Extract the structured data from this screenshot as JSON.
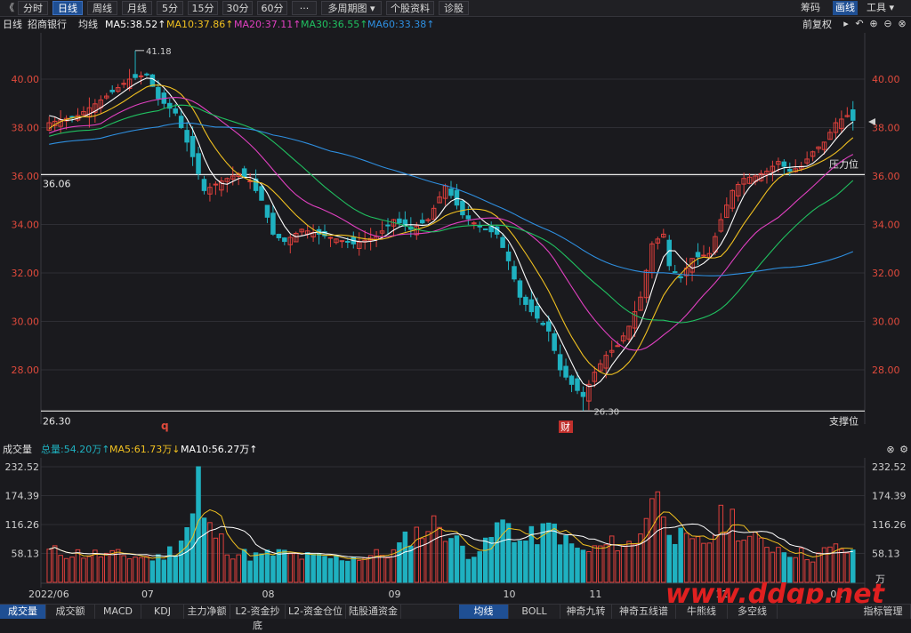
{
  "toolbar": {
    "back_glyph": "《",
    "tabs": [
      "分时",
      "日线",
      "周线",
      "月线",
      "5分",
      "15分",
      "30分",
      "60分",
      "···",
      "多周期图 ▾",
      "个股资料",
      "诊股"
    ],
    "active_tab": 1,
    "right": {
      "chips": "筹码",
      "draw": "画线",
      "tools": "工具 ▾"
    }
  },
  "legend": {
    "period": "日线",
    "stock": "招商银行",
    "mode": "均线",
    "ma5": "MA5:38.52↑",
    "ma10": "MA10:37.86↑",
    "ma20": "MA20:37.11↑",
    "ma30": "MA30:36.55↑",
    "ma60": "MA60:33.38↑",
    "adjust": "前复权",
    "colors": {
      "ma5": "#ffffff",
      "ma10": "#f0c020",
      "ma20": "#e040c0",
      "ma30": "#20c060",
      "ma60": "#2e8fe0",
      "up": "#e0403c",
      "down": "#1fb1c0"
    }
  },
  "volume_legend": {
    "title": "成交量",
    "total": "总量:54.20万↑",
    "ma5": "MA5:61.73万↓",
    "ma10": "MA10:56.27万↑"
  },
  "annotations": {
    "high_label": "41.18",
    "low_label": "26.30",
    "resistance_value": "36.06",
    "resistance_text": "压力位",
    "support_value": "26.30",
    "support_text": "支撑位",
    "q_marker": "q",
    "fin_marker": "财",
    "watermark": "www.ddgp.net",
    "vol_unit": "万"
  },
  "bottom_tabs": [
    "成交量",
    "成交额",
    "MACD",
    "KDJ",
    "主力净额",
    "L2-资金抄底",
    "L2-资金仓位",
    "陆股通资金",
    "均线",
    "BOLL",
    "神奇九转",
    "神奇五线谱",
    "牛熊线",
    "多空线",
    "指标管理"
  ],
  "bottom_active": [
    0,
    8
  ],
  "chart_data": [
    {
      "type": "candlestick",
      "title": "招商银行 日线",
      "ylim": [
        26.3,
        41.18
      ],
      "yticks": [
        28.0,
        30.0,
        32.0,
        34.0,
        36.0,
        38.0,
        40.0
      ],
      "ytick_labels": [
        "28.00",
        "30.00",
        "32.00",
        "34.00",
        "36.00",
        "38.00",
        "40.00"
      ],
      "xticks": [
        {
          "label": "2022/06",
          "index": 0
        },
        {
          "label": "07",
          "index": 17
        },
        {
          "label": "08",
          "index": 38
        },
        {
          "label": "09",
          "index": 60
        },
        {
          "label": "10",
          "index": 80
        },
        {
          "label": "11",
          "index": 95
        },
        {
          "label": "12",
          "index": 117
        },
        {
          "label": "01",
          "index": 137
        }
      ],
      "resistance": 36.06,
      "support": 26.3,
      "high": 41.18,
      "low": 26.3,
      "close_keypoints": [
        [
          0,
          38.2
        ],
        [
          5,
          38.5
        ],
        [
          10,
          39.3
        ],
        [
          14,
          40.0
        ],
        [
          17,
          40.2
        ],
        [
          19,
          39.2
        ],
        [
          22,
          38.6
        ],
        [
          25,
          36.8
        ],
        [
          27,
          35.4
        ],
        [
          30,
          35.8
        ],
        [
          33,
          36.1
        ],
        [
          35,
          35.8
        ],
        [
          37,
          35.0
        ],
        [
          39,
          33.6
        ],
        [
          41,
          33.3
        ],
        [
          44,
          33.8
        ],
        [
          47,
          33.6
        ],
        [
          50,
          33.4
        ],
        [
          53,
          33.2
        ],
        [
          57,
          33.5
        ],
        [
          60,
          34.2
        ],
        [
          63,
          33.8
        ],
        [
          66,
          34.2
        ],
        [
          69,
          35.6
        ],
        [
          72,
          34.4
        ],
        [
          75,
          33.9
        ],
        [
          78,
          33.6
        ],
        [
          80,
          32.5
        ],
        [
          82,
          31.0
        ],
        [
          84,
          30.4
        ],
        [
          87,
          29.6
        ],
        [
          89,
          28.0
        ],
        [
          91,
          27.4
        ],
        [
          93,
          26.9
        ],
        [
          95,
          27.9
        ],
        [
          97,
          28.6
        ],
        [
          99,
          29.0
        ],
        [
          101,
          29.8
        ],
        [
          103,
          31.0
        ],
        [
          105,
          33.2
        ],
        [
          107,
          33.6
        ],
        [
          108,
          32.3
        ],
        [
          110,
          31.8
        ],
        [
          112,
          32.6
        ],
        [
          115,
          32.8
        ],
        [
          117,
          34.2
        ],
        [
          119,
          35.4
        ],
        [
          121,
          35.9
        ],
        [
          123,
          36.0
        ],
        [
          125,
          36.2
        ],
        [
          127,
          36.6
        ],
        [
          129,
          36.2
        ],
        [
          131,
          36.4
        ],
        [
          133,
          37.0
        ],
        [
          135,
          37.4
        ],
        [
          137,
          38.2
        ],
        [
          139,
          38.5
        ],
        [
          140,
          38.3
        ]
      ],
      "series": [
        {
          "name": "MA5",
          "last": 38.52
        },
        {
          "name": "MA10",
          "last": 37.86
        },
        {
          "name": "MA20",
          "last": 37.11
        },
        {
          "name": "MA30",
          "last": 36.55
        },
        {
          "name": "MA60",
          "last": 33.38
        }
      ]
    },
    {
      "type": "bar",
      "title": "成交量",
      "ylim": [
        0,
        232.52
      ],
      "yticks": [
        58.13,
        116.26,
        174.39,
        232.52
      ],
      "ytick_labels": [
        "58.13",
        "116.26",
        "174.39",
        "232.52"
      ],
      "unit": "万",
      "volume_keypoints": [
        [
          0,
          62
        ],
        [
          5,
          58
        ],
        [
          10,
          55
        ],
        [
          15,
          52
        ],
        [
          19,
          48
        ],
        [
          22,
          70
        ],
        [
          25,
          135
        ],
        [
          26,
          232
        ],
        [
          27,
          120
        ],
        [
          29,
          95
        ],
        [
          32,
          60
        ],
        [
          36,
          52
        ],
        [
          40,
          58
        ],
        [
          45,
          50
        ],
        [
          50,
          48
        ],
        [
          55,
          52
        ],
        [
          60,
          60
        ],
        [
          63,
          95
        ],
        [
          66,
          110
        ],
        [
          68,
          120
        ],
        [
          70,
          90
        ],
        [
          73,
          60
        ],
        [
          76,
          72
        ],
        [
          78,
          110
        ],
        [
          80,
          120
        ],
        [
          82,
          80
        ],
        [
          85,
          95
        ],
        [
          88,
          110
        ],
        [
          90,
          80
        ],
        [
          93,
          60
        ],
        [
          96,
          70
        ],
        [
          99,
          80
        ],
        [
          102,
          75
        ],
        [
          105,
          178
        ],
        [
          107,
          150
        ],
        [
          109,
          95
        ],
        [
          112,
          75
        ],
        [
          115,
          85
        ],
        [
          117,
          125
        ],
        [
          119,
          130
        ],
        [
          121,
          90
        ],
        [
          124,
          80
        ],
        [
          127,
          70
        ],
        [
          130,
          60
        ],
        [
          133,
          52
        ],
        [
          136,
          65
        ],
        [
          138,
          70
        ],
        [
          140,
          54.2
        ]
      ],
      "series": [
        {
          "name": "MA5",
          "last": 61.73
        },
        {
          "name": "MA10",
          "last": 56.27
        }
      ]
    }
  ]
}
